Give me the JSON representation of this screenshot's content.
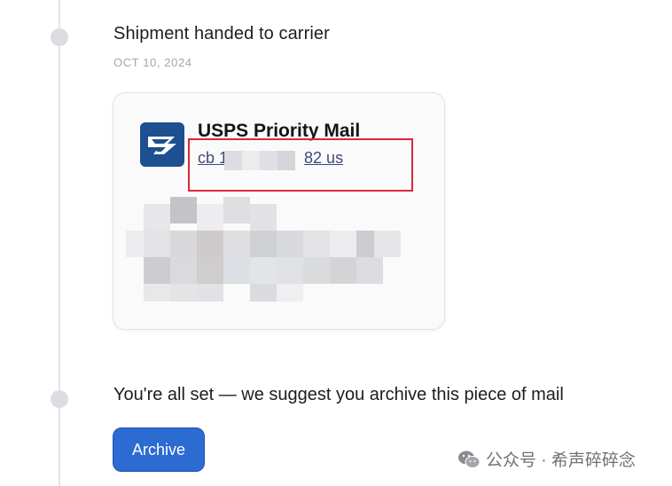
{
  "timeline": {
    "event_shipped": {
      "title": "Shipment handed to carrier",
      "date": "OCT 10, 2024"
    },
    "card": {
      "carrier_name": "USPS Priority Mail",
      "tracking_prefix": "cb 1",
      "tracking_suffix": "82 us",
      "logo_icon": "usps-eagle-icon",
      "logo_color": "#1d4f91"
    },
    "event_done": {
      "message": "You're all set — we suggest you archive this piece of mail"
    }
  },
  "actions": {
    "archive_label": "Archive",
    "accent_color": "#2c6bd2"
  },
  "watermark": {
    "text": "公众号 · 希声碎碎念",
    "icon": "wechat-icon"
  }
}
